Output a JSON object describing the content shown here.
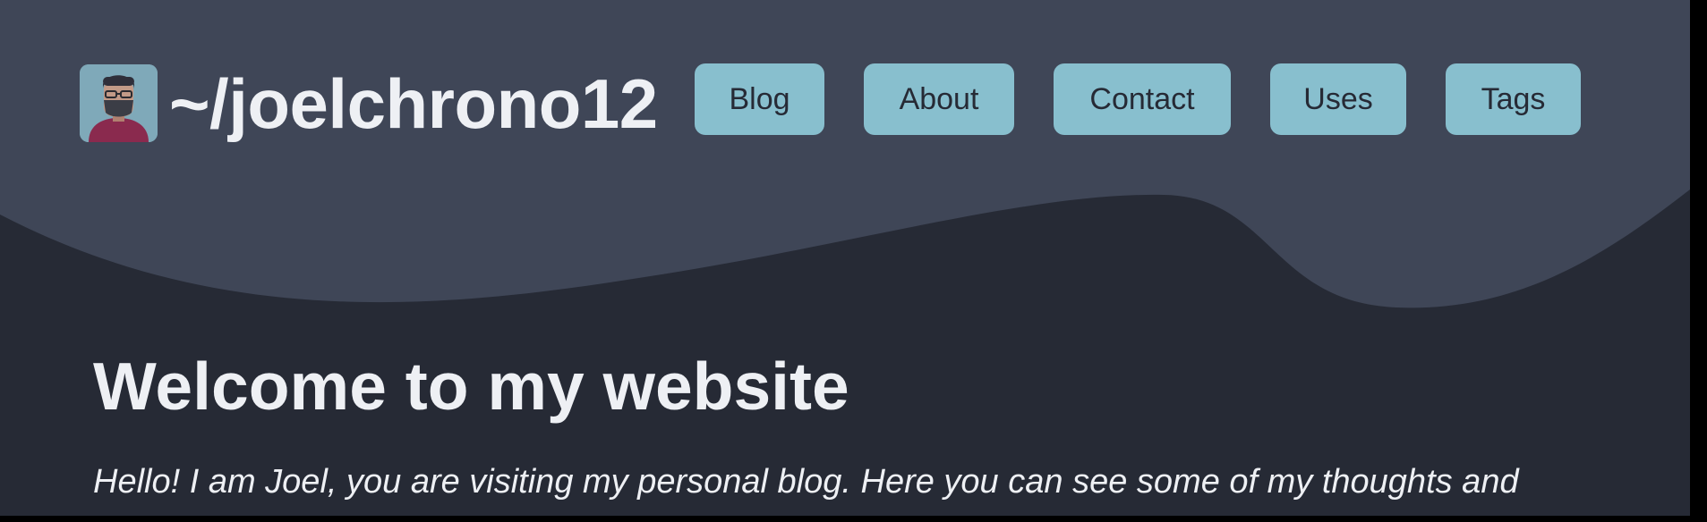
{
  "header": {
    "site_title": "~/joelchrono12",
    "nav": [
      {
        "label": "Blog"
      },
      {
        "label": "About"
      },
      {
        "label": "Contact"
      },
      {
        "label": "Uses"
      },
      {
        "label": "Tags"
      }
    ]
  },
  "main": {
    "title": "Welcome to my website",
    "intro": "Hello! I am Joel, you are visiting my personal blog. Here you can see some of my thoughts and"
  },
  "colors": {
    "header_bg": "#3f4657",
    "page_bg": "#262a35",
    "nav_button_bg": "#88bfce",
    "text": "#eef0f4"
  }
}
